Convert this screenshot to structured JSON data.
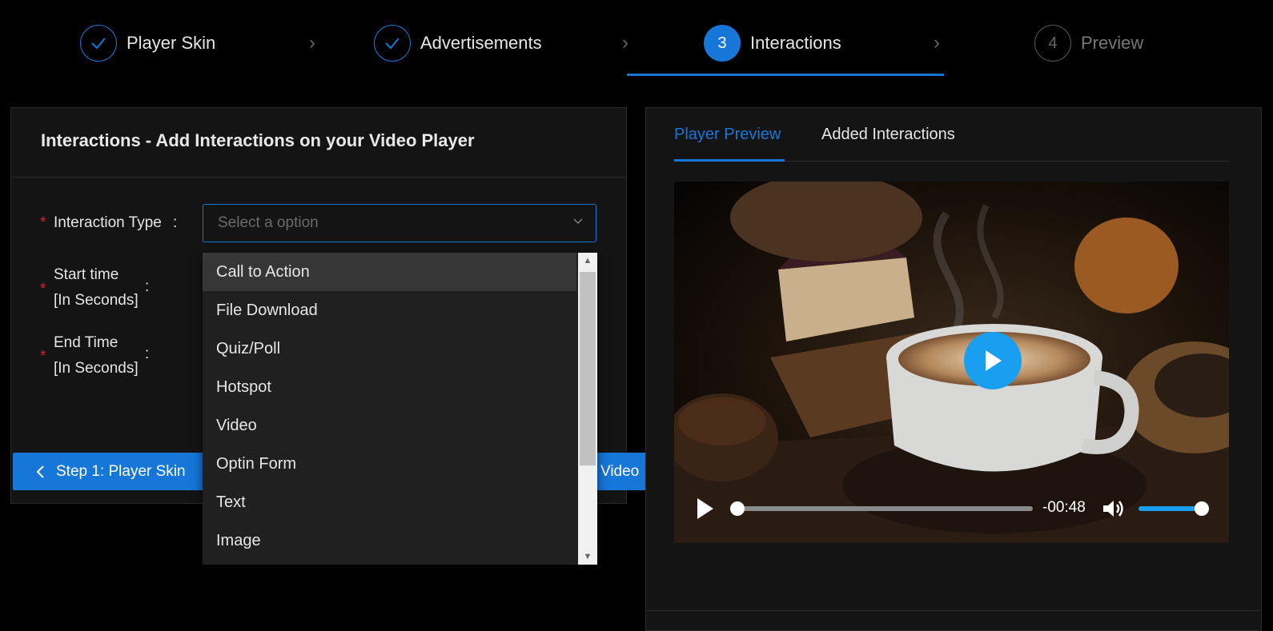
{
  "steps": [
    {
      "number": "",
      "label": "Player Skin",
      "state": "done"
    },
    {
      "number": "",
      "label": "Advertisements",
      "state": "done"
    },
    {
      "number": "3",
      "label": "Interactions",
      "state": "active"
    },
    {
      "number": "4",
      "label": "Preview",
      "state": "pending"
    }
  ],
  "left_panel": {
    "title": "Interactions - Add Interactions on your Video Player",
    "interaction_type_label": "Interaction Type",
    "select_placeholder": "Select a option",
    "start_time_label_line1": "Start time",
    "start_time_label_line2": "[In Seconds]",
    "end_time_label_line1": "End Time",
    "end_time_label_line2": "[In Seconds]",
    "required_mark": "*",
    "colon": ":",
    "back_button_label": "Step 1: Player Skin",
    "next_button_partial": "Video"
  },
  "dropdown": {
    "options": [
      "Call to Action",
      "File Download",
      "Quiz/Poll",
      "Hotspot",
      "Video",
      "Optin Form",
      "Text",
      "Image"
    ],
    "highlighted": "Call to Action"
  },
  "right_panel": {
    "tabs": [
      {
        "label": "Player Preview",
        "active": true
      },
      {
        "label": "Added Interactions",
        "active": false
      }
    ],
    "video": {
      "time_remaining": "-00:48",
      "progress": 0.0,
      "volume": 1.0
    }
  },
  "colors": {
    "accent": "#1677d9",
    "required": "#d32029",
    "play_button": "#1a9ff0"
  }
}
